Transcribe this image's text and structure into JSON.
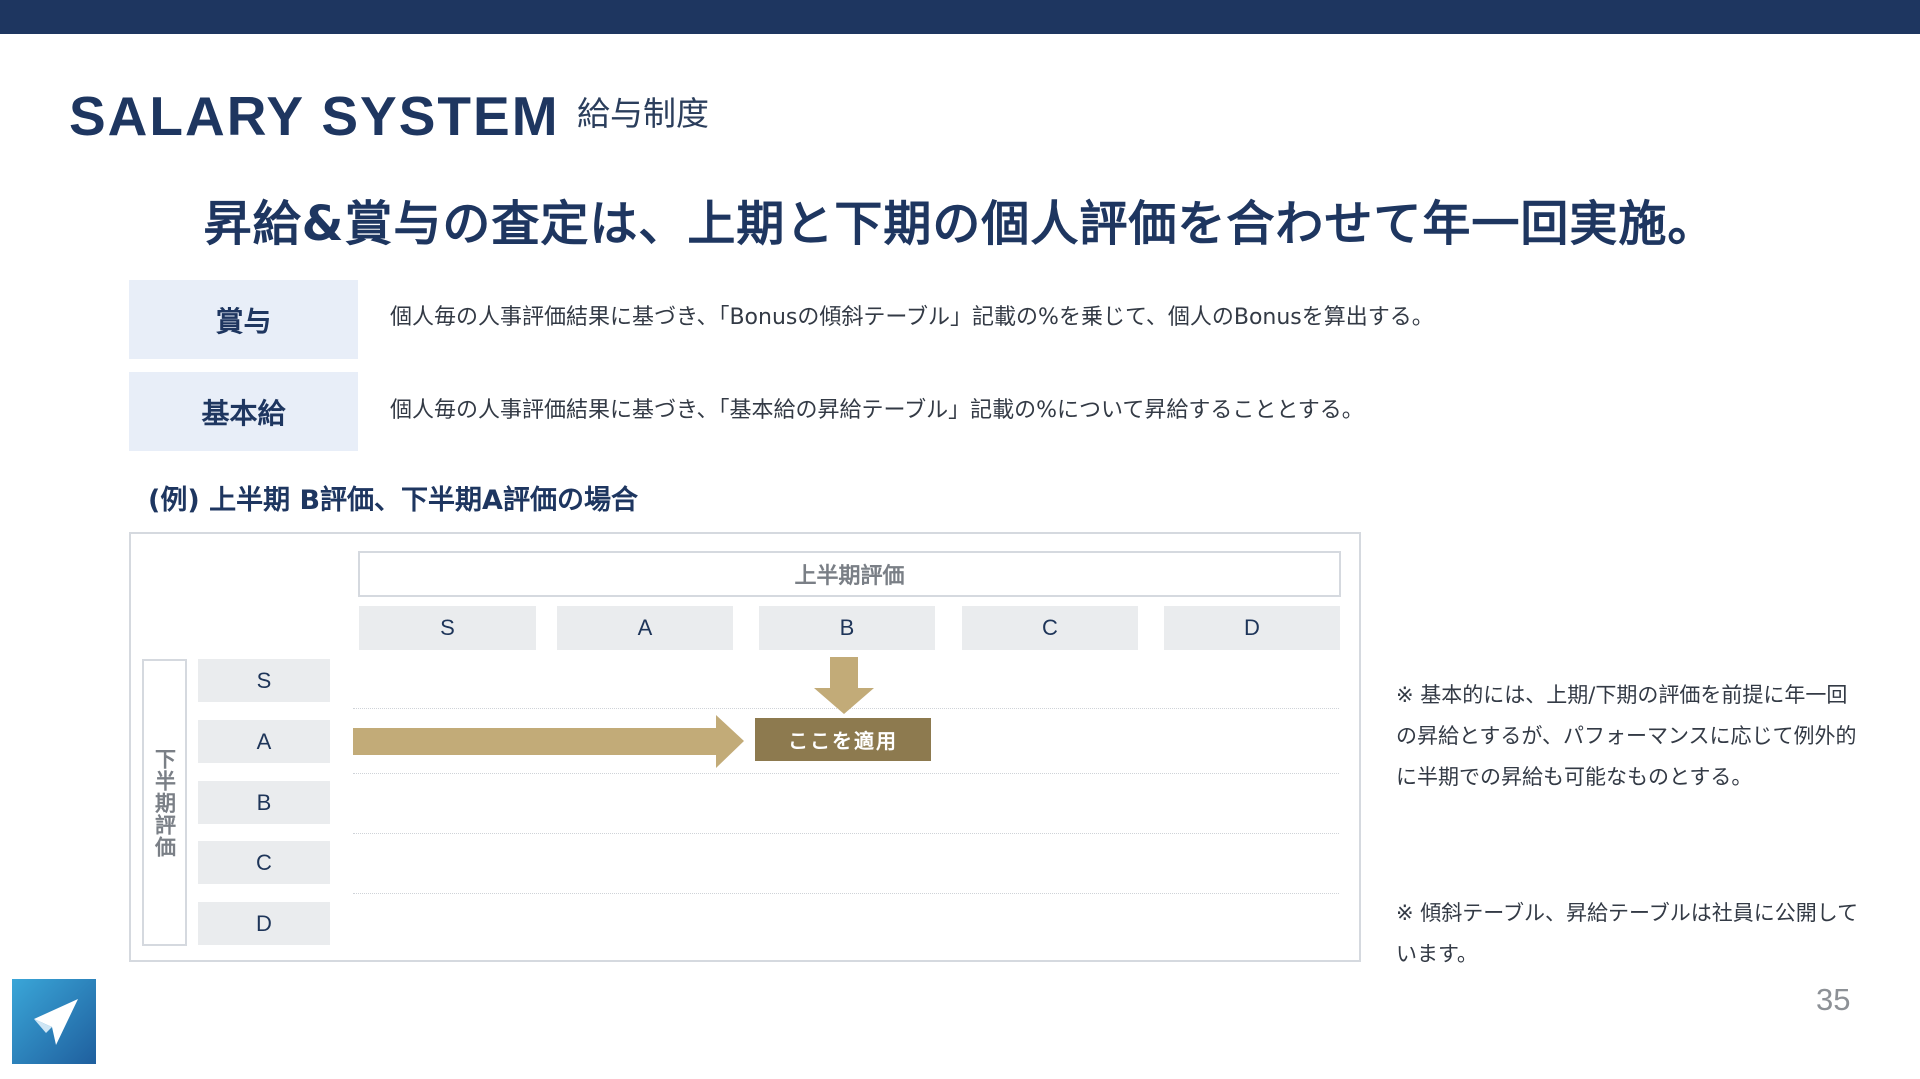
{
  "header": {
    "title_en": "SALARY SYSTEM",
    "title_ja": "給与制度"
  },
  "headline": "昇給&賞与の査定は、上期と下期の個人評価を合わせて年一回実施。",
  "rows": [
    {
      "label": "賞与",
      "description": "個人毎の人事評価結果に基づき、「Bonusの傾斜テーブル」記載の%を乗じて、個人のBonusを算出する。"
    },
    {
      "label": "基本給",
      "description": "個人毎の人事評価結果に基づき、「基本給の昇給テーブル」記載の%について昇給することとする。"
    }
  ],
  "example": {
    "label": "(例) 上半期 B評価、下半期A評価の場合",
    "upper_axis_label": "上半期評価",
    "lower_axis_label": "下半期評価",
    "upper_grades": [
      "S",
      "A",
      "B",
      "C",
      "D"
    ],
    "lower_grades": [
      "S",
      "A",
      "B",
      "C",
      "D"
    ],
    "apply_label": "ここを適用",
    "selected_upper": "B",
    "selected_lower": "A",
    "arrow_color": "#c2ab78",
    "apply_color": "#8d7a4f"
  },
  "notes": [
    "※ 基本的には、上期/下期の評価を前提に年一回の昇給とするが、パフォーマンスに応じて例外的に半期での昇給も可能なものとする。",
    "※ 傾斜テーブル、昇給テーブルは社員に公開しています。"
  ],
  "page_number": "35",
  "colors": {
    "brand_navy": "#1e3660",
    "label_bg": "#e8eef8",
    "cell_bg": "#eaecee"
  },
  "logo_icon": "paper-plane-logo-icon"
}
